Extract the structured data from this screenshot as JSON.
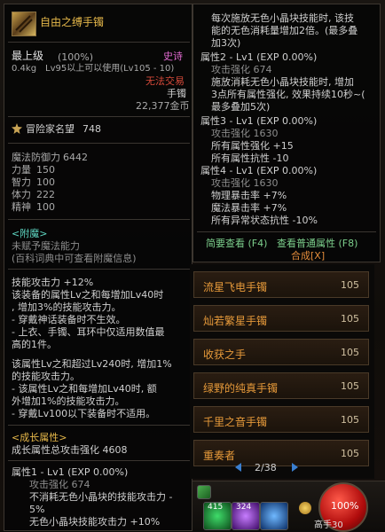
{
  "left_panel": {
    "item_name": "自由之缚手镯",
    "rarity_line": "最上级",
    "rarity_pct": "(100%)",
    "grade": "史诗",
    "weight": "0.4kg",
    "req_level": "Lv95以上可以使用(Lv105 - 10)",
    "trade": "无法交易",
    "slot": "手镯",
    "price": "22,377金币",
    "fame_label": "冒险家名望",
    "fame_value": "748",
    "stats": [
      {
        "label": "魔法防御力",
        "value": "6442"
      },
      {
        "label": "力量",
        "value": "150"
      },
      {
        "label": "智力",
        "value": "100"
      },
      {
        "label": "体力",
        "value": "222"
      },
      {
        "label": "精神",
        "value": "100"
      }
    ],
    "enchant_title": "<附魔>",
    "enchant_line1": "未赋予魔法能力",
    "enchant_line2": "(百科词典中可查看附魔信息)",
    "skill_lines": [
      "技能攻击力 +12%",
      "该装备的属性Lv之和每增加Lv40时",
      ", 增加3%的技能攻击力。",
      "- 穿戴神话装备时不生效。",
      "- 上衣、手镯、耳环中仅适用数值最",
      "高的1件。",
      "",
      "该属性Lv之和超过Lv240时, 增加1%",
      "的技能攻击力。",
      "- 该属性Lv之和每增加Lv40时, 额",
      "外增加1%的技能攻击力。",
      "- 穿戴Lv100以下装备时不适用。"
    ],
    "growth_title": "<成长属性>",
    "growth_total": "成长属性总攻击强化 4608",
    "attr1_title": "属性1 - Lv1 (EXP 0.00%)",
    "attr1_lines": [
      "攻击强化 674",
      "不消耗无色小晶块的技能攻击力 -",
      "5%",
      "无色小晶块技能攻击力 +10%"
    ]
  },
  "right_panel": {
    "lines_top": [
      "每次施放无色小晶块技能时, 该技",
      "能的无色消耗量增加2倍。(最多叠",
      "加3次)"
    ],
    "attr2_title": "属性2 - Lv1 (EXP 0.00%)",
    "attr2_lines": [
      "攻击强化 674",
      "施放消耗无色小晶块技能时, 增加",
      "3点所有属性强化, 效果持续10秒~(",
      "最多叠加5次)"
    ],
    "attr3_title": "属性3 - Lv1 (EXP 0.00%)",
    "attr3_lines": [
      "攻击强化 1630",
      "所有属性强化 +15",
      "所有属性抗性 -10"
    ],
    "attr4_title": "属性4 - Lv1 (EXP 0.00%)",
    "attr4_lines": [
      "攻击强化 1630",
      "物理暴击率 +7%",
      "魔法暴击率 +7%",
      "所有异常状态抗性 -10%"
    ],
    "simple_view": "简要查看 (F4)",
    "normal_view": "查看普通属性 (F8)",
    "synthesis": "合成[X]"
  },
  "item_list": {
    "rows": [
      {
        "name": "流星飞电手镯",
        "level": "105"
      },
      {
        "name": "灿若繁星手镯",
        "level": "105"
      },
      {
        "name": "收获之手",
        "level": "105"
      },
      {
        "name": "绿野的纯真手镯",
        "level": "105"
      },
      {
        "name": "千里之音手镯",
        "level": "105"
      },
      {
        "name": "重奏者",
        "level": "105"
      }
    ],
    "page": "2/38"
  },
  "hud": {
    "hp": "100%",
    "slot1_count": "415",
    "slot2_count": "324",
    "bottom_label": "高手30"
  }
}
